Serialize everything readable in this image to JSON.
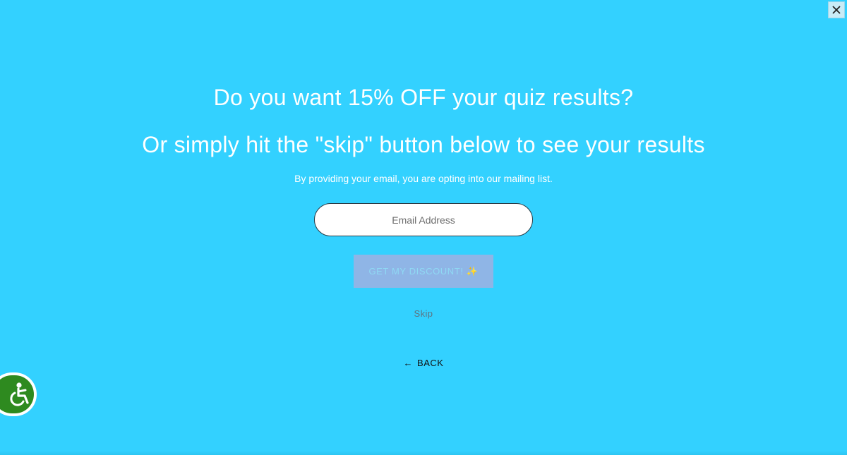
{
  "popup": {
    "headline": "Do you want 15% OFF your quiz results?",
    "subhead": "Or simply hit the \"skip\" button below to see your results",
    "disclaimer": "By providing your email, you are opting into our mailing list.",
    "email_placeholder": "Email Address",
    "email_value": "",
    "discount_button_label": "GET MY DISCOUNT! ✨",
    "skip_label": "Skip",
    "back_label": "BACK",
    "back_arrow": "←"
  },
  "icons": {
    "close": "close-icon",
    "accessibility": "accessibility-icon"
  },
  "colors": {
    "background": "#33d1ff",
    "text": "#ffffff",
    "button_bg": "#8fb5e6",
    "accessibility_green": "#2e8a1f"
  }
}
